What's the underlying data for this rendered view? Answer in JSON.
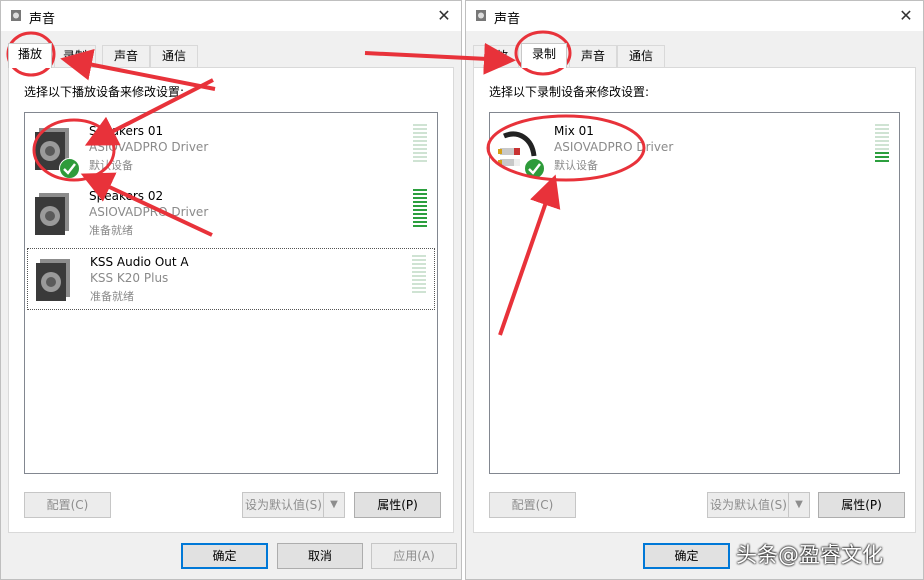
{
  "left_window": {
    "title": "声音",
    "tabs": [
      {
        "label": "播放"
      },
      {
        "label": "录制"
      },
      {
        "label": "声音"
      },
      {
        "label": "通信"
      }
    ],
    "instruction": "选择以下播放设备来修改设置:",
    "devices": [
      {
        "name": "Speakers 01",
        "driver": "ASIOVADPRO Driver",
        "status": "默认设备",
        "meter_level": 0
      },
      {
        "name": "Speakers 02",
        "driver": "ASIOVADPRO Driver",
        "status": "准备就绪",
        "meter_level": 1
      },
      {
        "name": "KSS Audio Out A",
        "driver": "KSS K20 Plus",
        "status": "准备就绪",
        "meter_level": 0
      }
    ],
    "buttons": {
      "configure": "配置(C)",
      "set_default": "设为默认值(S)",
      "properties": "属性(P)"
    },
    "footer": {
      "ok": "确定",
      "cancel": "取消",
      "apply": "应用(A)"
    }
  },
  "right_window": {
    "title": "声音",
    "tabs": [
      {
        "label": "播放"
      },
      {
        "label": "录制"
      },
      {
        "label": "声音"
      },
      {
        "label": "通信"
      }
    ],
    "instruction": "选择以下录制设备来修改设置:",
    "devices": [
      {
        "name": "Mix 01",
        "driver": "ASIOVADPRO Driver",
        "status": "默认设备",
        "meter_level": 0.3
      }
    ],
    "buttons": {
      "configure": "配置(C)",
      "set_default": "设为默认值(S)",
      "properties": "属性(P)"
    },
    "footer": {
      "ok": "确定"
    }
  },
  "watermark": "头条@盈睿文化",
  "colors": {
    "annotation": "#e8323a",
    "check": "#2e9b3a",
    "meter_on": "#2c9f3e",
    "meter_off": "#cfe3d3",
    "focus": "#0078d7"
  }
}
